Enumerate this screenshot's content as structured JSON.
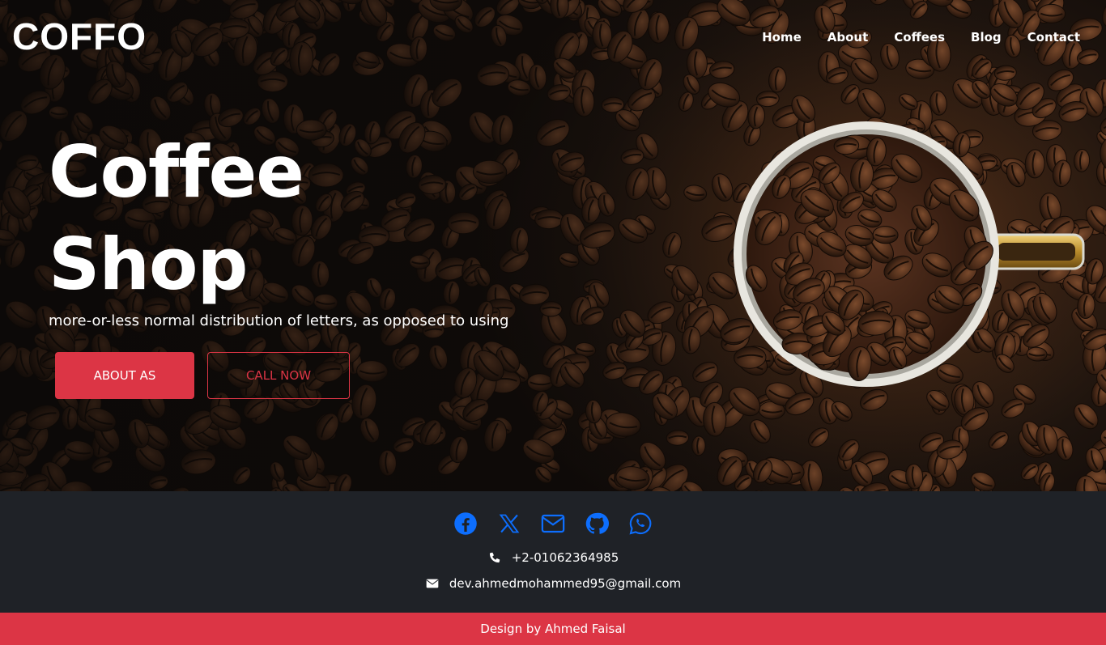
{
  "header": {
    "logo": "COFFO",
    "nav": [
      "Home",
      "About",
      "Coffees",
      "Blog",
      "Contact"
    ]
  },
  "hero": {
    "title_line1": "Coffee",
    "title_line2": "Shop",
    "subtitle": "more-or-less normal distribution of letters, as opposed to using",
    "primary_button": "ABOUT AS",
    "secondary_button": "CALL NOW",
    "image": "coffee-cup-with-beans"
  },
  "footer": {
    "socials": [
      "facebook-icon",
      "x-icon",
      "mail-icon",
      "github-icon",
      "whatsapp-icon"
    ],
    "phone": "+2-01062364985",
    "email": "dev.ahmedmohammed95@gmail.com",
    "credit": "Design by Ahmed Faisal"
  },
  "colors": {
    "accent": "#dc3545",
    "social_icon": "#0d6efd",
    "footer_bg": "#1f2227"
  }
}
